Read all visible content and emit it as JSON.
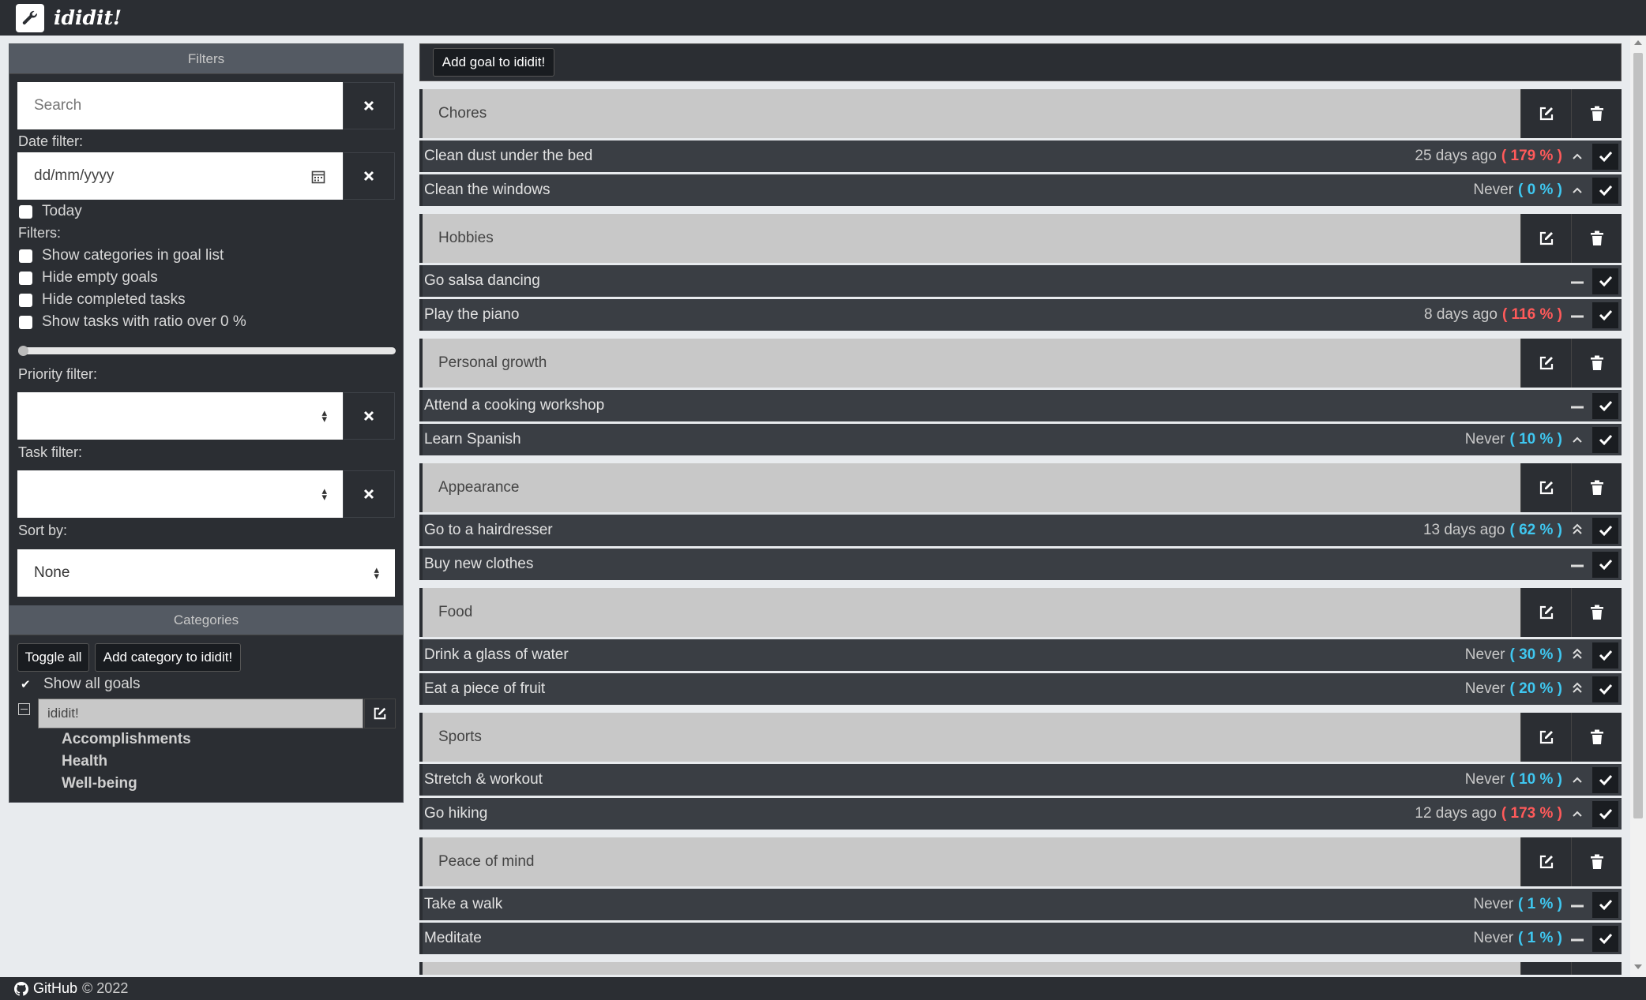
{
  "app": {
    "title": "ididit!"
  },
  "filters": {
    "header": "Filters",
    "search_placeholder": "Search",
    "date_label": "Date filter:",
    "date_placeholder": "dd/mm/yyyy",
    "today_label": "Today",
    "filters_label": "Filters:",
    "options": [
      "Show categories in goal list",
      "Hide empty goals",
      "Hide completed tasks",
      "Show tasks with ratio over 0 %"
    ],
    "ratio_slider_value": 0,
    "priority_label": "Priority filter:",
    "task_label": "Task filter:",
    "sort_label": "Sort by:",
    "sort_value": "None"
  },
  "categories": {
    "header": "Categories",
    "toggle_all": "Toggle all",
    "add_category": "Add category to ididit!",
    "show_all": "Show all goals",
    "root": "ididit!",
    "children": [
      "Accomplishments",
      "Health",
      "Well-being"
    ]
  },
  "main": {
    "add_goal": "Add goal to ididit!",
    "groups": [
      {
        "title": "Chores",
        "goals": [
          {
            "name": "Clean dust under the bed",
            "ago": "25 days ago",
            "pct": "( 179 % )",
            "status": "over",
            "priority": "up"
          },
          {
            "name": "Clean the windows",
            "ago": "Never",
            "pct": "( 0 % )",
            "status": "under",
            "priority": "up"
          }
        ]
      },
      {
        "title": "Hobbies",
        "goals": [
          {
            "name": "Go salsa dancing",
            "ago": "",
            "pct": "",
            "status": "none",
            "priority": "none"
          },
          {
            "name": "Play the piano",
            "ago": "8 days ago",
            "pct": "( 116 % )",
            "status": "over",
            "priority": "none"
          }
        ]
      },
      {
        "title": "Personal growth",
        "goals": [
          {
            "name": "Attend a cooking workshop",
            "ago": "",
            "pct": "",
            "status": "none",
            "priority": "none"
          },
          {
            "name": "Learn Spanish",
            "ago": "Never",
            "pct": "( 10 % )",
            "status": "under",
            "priority": "up"
          }
        ]
      },
      {
        "title": "Appearance",
        "goals": [
          {
            "name": "Go to a hairdresser",
            "ago": "13 days ago",
            "pct": "( 62 % )",
            "status": "under",
            "priority": "double-up"
          },
          {
            "name": "Buy new clothes",
            "ago": "",
            "pct": "",
            "status": "none",
            "priority": "none"
          }
        ]
      },
      {
        "title": "Food",
        "goals": [
          {
            "name": "Drink a glass of water",
            "ago": "Never",
            "pct": "( 30 % )",
            "status": "under",
            "priority": "double-up"
          },
          {
            "name": "Eat a piece of fruit",
            "ago": "Never",
            "pct": "( 20 % )",
            "status": "under",
            "priority": "double-up"
          }
        ]
      },
      {
        "title": "Sports",
        "goals": [
          {
            "name": "Stretch & workout",
            "ago": "Never",
            "pct": "( 10 % )",
            "status": "under",
            "priority": "up"
          },
          {
            "name": "Go hiking",
            "ago": "12 days ago",
            "pct": "( 173 % )",
            "status": "over",
            "priority": "up"
          }
        ]
      },
      {
        "title": "Peace of mind",
        "goals": [
          {
            "name": "Take a walk",
            "ago": "Never",
            "pct": "( 1 % )",
            "status": "under",
            "priority": "none"
          },
          {
            "name": "Meditate",
            "ago": "Never",
            "pct": "( 1 % )",
            "status": "under",
            "priority": "none"
          }
        ]
      },
      {
        "title": "",
        "goals": []
      }
    ]
  },
  "footer": {
    "link": "GitHub",
    "copyright": "© 2022"
  },
  "colors": {
    "over": "#ff5a5a",
    "under": "#3fc7f0",
    "panel": "#2b2e33",
    "row": "#3a3e44"
  }
}
